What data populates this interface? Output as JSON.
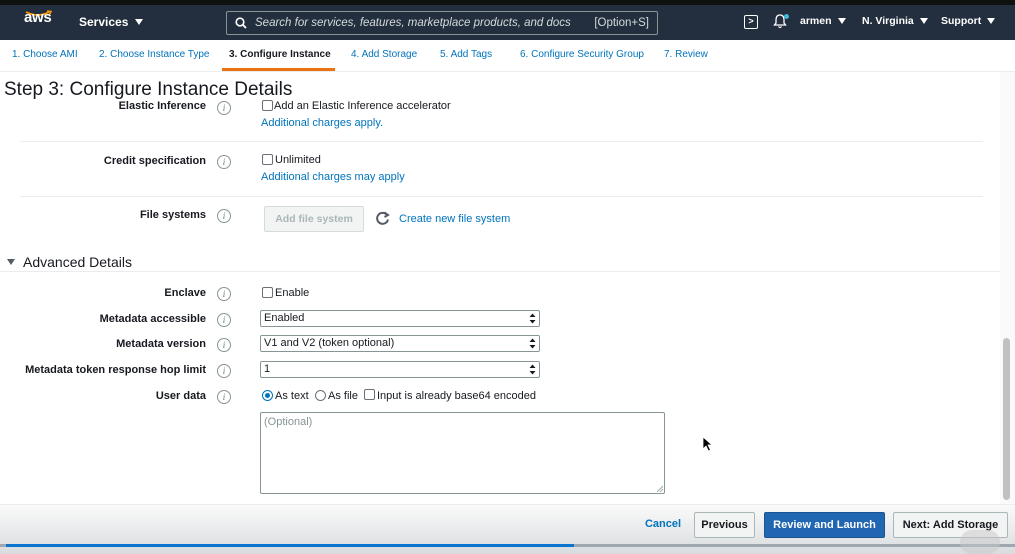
{
  "nav": {
    "logo": "aws",
    "services": "Services",
    "search_placeholder": "Search for services, features, marketplace products, and docs",
    "search_shortcut": "[Option+S]",
    "user": "armen",
    "region": "N. Virginia",
    "support": "Support"
  },
  "tabs": [
    {
      "label": "1. Choose AMI"
    },
    {
      "label": "2. Choose Instance Type"
    },
    {
      "label": "3. Configure Instance"
    },
    {
      "label": "4. Add Storage"
    },
    {
      "label": "5. Add Tags"
    },
    {
      "label": "6. Configure Security Group"
    },
    {
      "label": "7. Review"
    }
  ],
  "page_title": "Step 3: Configure Instance Details",
  "fields": {
    "elastic_inference": {
      "label": "Elastic Inference",
      "checkbox_label": "Add an Elastic Inference accelerator",
      "note": "Additional charges apply."
    },
    "credit_specification": {
      "label": "Credit specification",
      "checkbox_label": "Unlimited",
      "note": "Additional charges may apply"
    },
    "file_systems": {
      "label": "File systems",
      "add_button": "Add file system",
      "create_link": "Create new file system"
    }
  },
  "advanced": {
    "title": "Advanced Details",
    "enclave": {
      "label": "Enclave",
      "checkbox_label": "Enable"
    },
    "metadata_accessible": {
      "label": "Metadata accessible",
      "value": "Enabled"
    },
    "metadata_version": {
      "label": "Metadata version",
      "value": "V1 and V2 (token optional)"
    },
    "hop_limit": {
      "label": "Metadata token response hop limit",
      "value": "1"
    },
    "user_data": {
      "label": "User data",
      "option_text": "As text",
      "option_file": "As file",
      "base64_label": "Input is already base64 encoded",
      "placeholder": "(Optional)"
    }
  },
  "footer": {
    "cancel": "Cancel",
    "previous": "Previous",
    "review_launch": "Review and Launch",
    "next": "Next: Add Storage",
    "progress": 0.56
  },
  "colors": {
    "nav_bg": "#232f3e",
    "link": "#0073bb",
    "active_tab": "#ec7211",
    "primary_button": "#2066b1"
  }
}
